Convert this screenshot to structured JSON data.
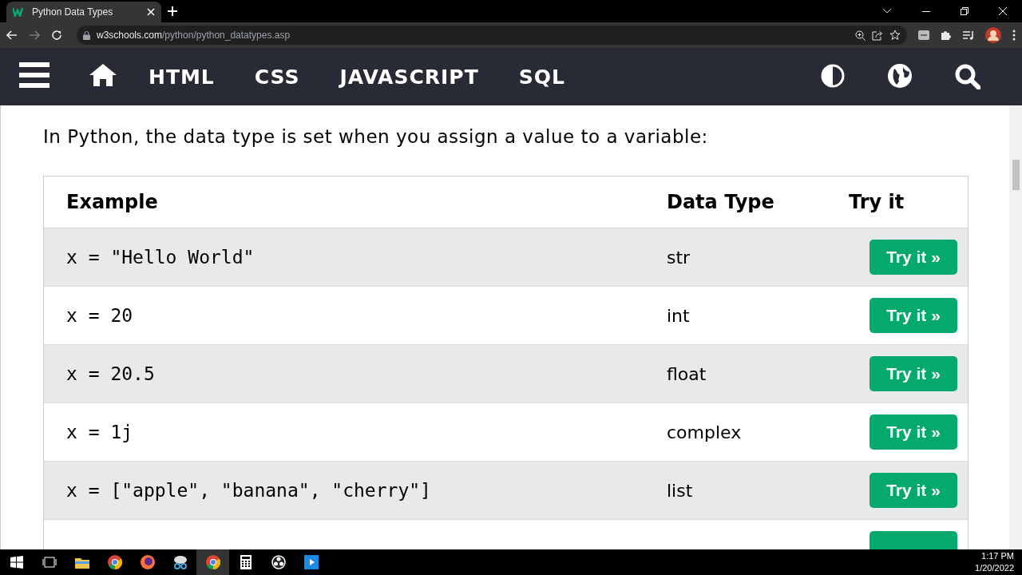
{
  "browser": {
    "tab_title": "Python Data Types",
    "url_domain": "w3schools.com",
    "url_path": "/python/python_datatypes.asp"
  },
  "nav": {
    "links": [
      "HTML",
      "CSS",
      "JAVASCRIPT",
      "SQL"
    ]
  },
  "intro": "In Python, the data type is set when you assign a value to a variable:",
  "table": {
    "columns": [
      "Example",
      "Data Type",
      "Try it"
    ],
    "rows": [
      {
        "example": "x = \"Hello World\"",
        "type": "str",
        "button": "Try it »"
      },
      {
        "example": "x = 20",
        "type": "int",
        "button": "Try it »"
      },
      {
        "example": "x = 20.5",
        "type": "float",
        "button": "Try it »"
      },
      {
        "example": "x = 1j",
        "type": "complex",
        "button": "Try it »"
      },
      {
        "example": "x = [\"apple\", \"banana\", \"cherry\"]",
        "type": "list",
        "button": "Try it »"
      }
    ]
  },
  "taskbar": {
    "time": "1:17 PM",
    "date": "1/20/2022"
  }
}
